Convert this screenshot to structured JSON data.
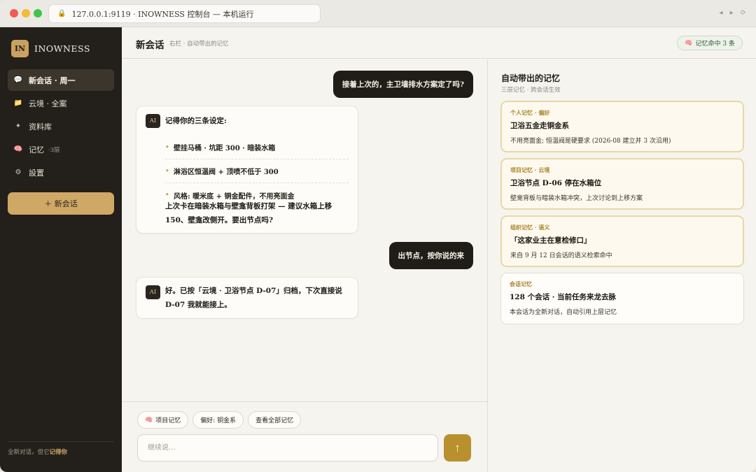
{
  "browser": {
    "url": "127.0.0.1:9119 · INOWNESS 控制台 — 本机运行",
    "nav": [
      "◂",
      "▸",
      "⟳"
    ]
  },
  "brand": {
    "logo": "IN",
    "name": "INOWNESS"
  },
  "sidebar": {
    "items": [
      {
        "icon": "chat-bubble-icon",
        "glyph": "💬",
        "label": "新会话 · 周一",
        "badge": "",
        "active": true
      },
      {
        "icon": "folder-icon",
        "glyph": "📁",
        "label": "云境 · 全案",
        "badge": ""
      },
      {
        "icon": "sparkle-icon",
        "glyph": "✦",
        "label": "资料库",
        "badge": ""
      },
      {
        "icon": "brain-icon",
        "glyph": "🧠",
        "label": "记忆",
        "badge": "·3层"
      },
      {
        "icon": "gear-icon",
        "glyph": "⚙",
        "label": "設置",
        "badge": ""
      }
    ],
    "new_chat_label": "＋ 新会话",
    "footer_text": "全新对话，但它",
    "footer_highlight": "记得你"
  },
  "header": {
    "title": "新会话",
    "subtitle": "右栏 · 自动带出的记忆",
    "badge_icon": "🧠",
    "badge": "记忆命中 3 条"
  },
  "chat": {
    "messages": [
      {
        "role": "user",
        "text": "接着上次的，主卫墙排水方案定了吗?"
      },
      {
        "role": "ai",
        "tag": "AI",
        "intro": "记得你的三条设定:",
        "items": [
          "壁挂马桶 · 坑距 300 · 暗装水箱",
          "淋浴区恒温阀 + 顶喷不低于 300",
          "风格: 暖米底 + 铜金配件，不用亮面金"
        ],
        "outro_line1": "上次卡在暗装水箱与壁龛背板打架 — 建议水箱上移",
        "outro_line2": "150、壁龛改侧开。要出节点吗?"
      },
      {
        "role": "user",
        "text": "出节点，按你说的来"
      },
      {
        "role": "ai",
        "tag": "AI",
        "line1": "好。已按「云境 · 卫浴节点 D-07」归档，下次直接说",
        "line2": "D-07 我就能接上。"
      }
    ]
  },
  "composer": {
    "chips": [
      {
        "icon": "🧠",
        "label": "项目记忆"
      },
      {
        "icon": "",
        "label": "偏好: 铜金系"
      },
      {
        "icon": "",
        "label": "查看全部记忆"
      }
    ],
    "placeholder": "继续说…",
    "send_glyph": "↑"
  },
  "memory": {
    "title": "自动带出的记忆",
    "subtitle": "三层记忆 · 跨会话生效",
    "cards": [
      {
        "kind": "个人记忆 · 偏好",
        "title": "卫浴五金走铜金系",
        "desc": "不用亮面金; 恒温阀是硬要求 (2026-08 建立并 3 次沿用)",
        "highlight": true
      },
      {
        "kind": "项目记忆 · 云境",
        "title": "卫浴节点 D-06 停在水箱位",
        "desc": "壁龛背板与暗装水箱冲突，上次讨论到上移方案",
        "highlight": true
      },
      {
        "kind": "组织记忆 · 语义",
        "title": "「这家业主在意检修口」",
        "desc": "来自 9 月 12 日会话的语义检索命中",
        "highlight": true
      },
      {
        "kind": "会话记忆",
        "title": "128 个会话 · 当前任务来龙去脉",
        "desc": "本会话为全新对话，自动引用上层记忆",
        "highlight": false
      }
    ]
  }
}
